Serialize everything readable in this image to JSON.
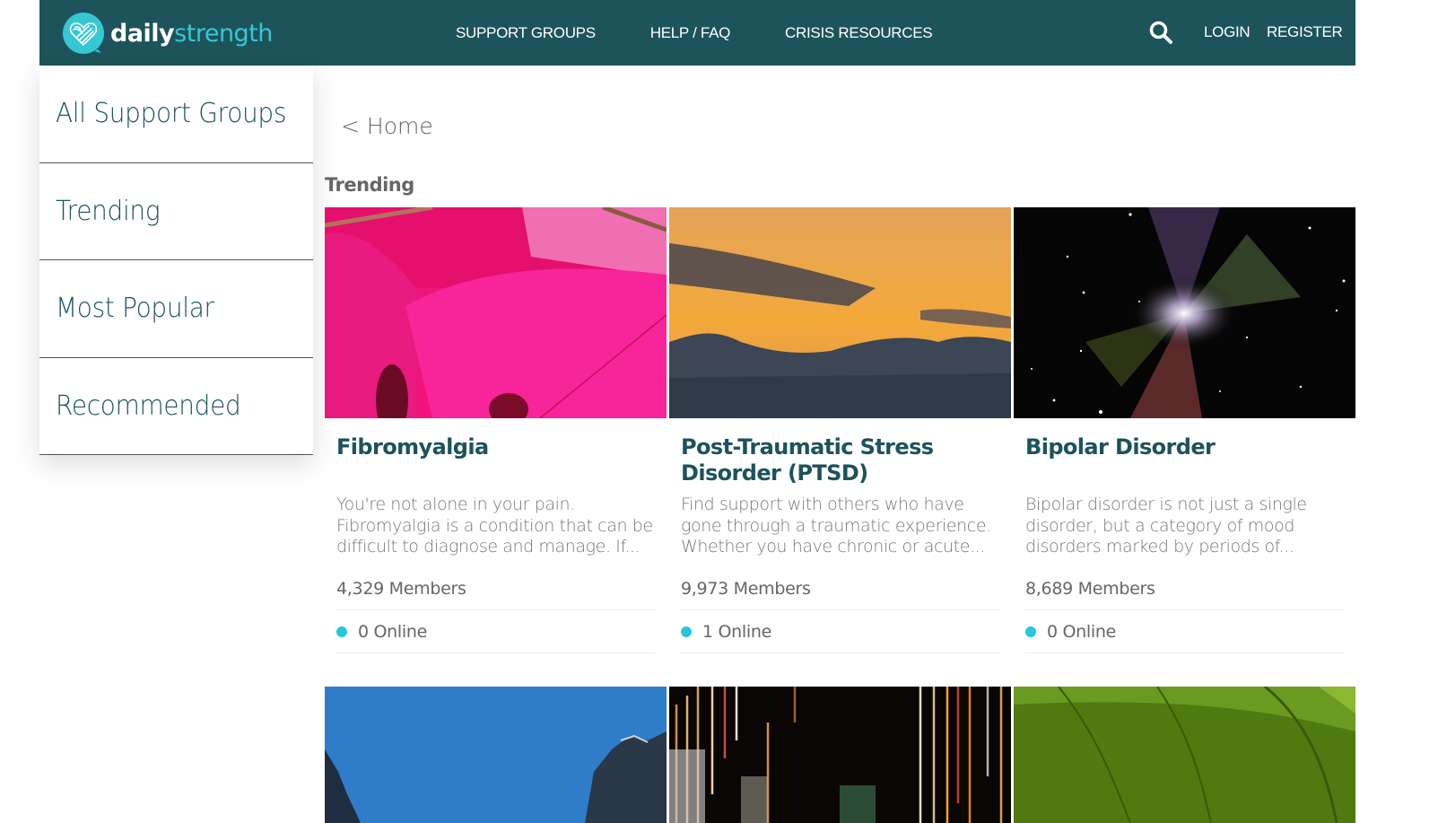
{
  "brand": {
    "name_part1": "daily",
    "name_part2": "strength",
    "logo_icon": "heart-fingerprint-icon",
    "primary_color": "#1d535b",
    "accent_color": "#35c8d3"
  },
  "header": {
    "nav": [
      {
        "label": "SUPPORT GROUPS"
      },
      {
        "label": "HELP / FAQ"
      },
      {
        "label": "CRISIS RESOURCES"
      }
    ],
    "search_icon": "search-icon",
    "login_label": "LOGIN",
    "register_label": "REGISTER"
  },
  "sidebar": {
    "items": [
      {
        "label": "All Support Groups"
      },
      {
        "label": "Trending"
      },
      {
        "label": "Most Popular"
      },
      {
        "label": "Recommended"
      }
    ]
  },
  "main": {
    "breadcrumb": "< Home",
    "section_title": "Trending",
    "online_dot_color": "#27c6d9",
    "groups": [
      {
        "title": "Fibromyalgia",
        "description": "You're not alone in your pain. Fibromyalgia is a condition that can be difficult to diagnose and manage. If...",
        "members": "4,329 Members",
        "online": "0 Online",
        "image": "pink-flower-petal"
      },
      {
        "title": "Post-Traumatic Stress Disorder (PTSD)",
        "description": "Find support with others who have gone through a traumatic experience. Whether you have chronic or acute...",
        "members": "9,973 Members",
        "online": "1 Online",
        "image": "sunset-clouds"
      },
      {
        "title": "Bipolar Disorder",
        "description": "Bipolar disorder is not just a single disorder, but a category of mood disorders marked by periods of...",
        "members": "8,689 Members",
        "online": "0 Online",
        "image": "nebula-space"
      }
    ],
    "next_row_images": [
      "blue-sky-mountains",
      "city-light-streaks",
      "green-leaf"
    ]
  }
}
